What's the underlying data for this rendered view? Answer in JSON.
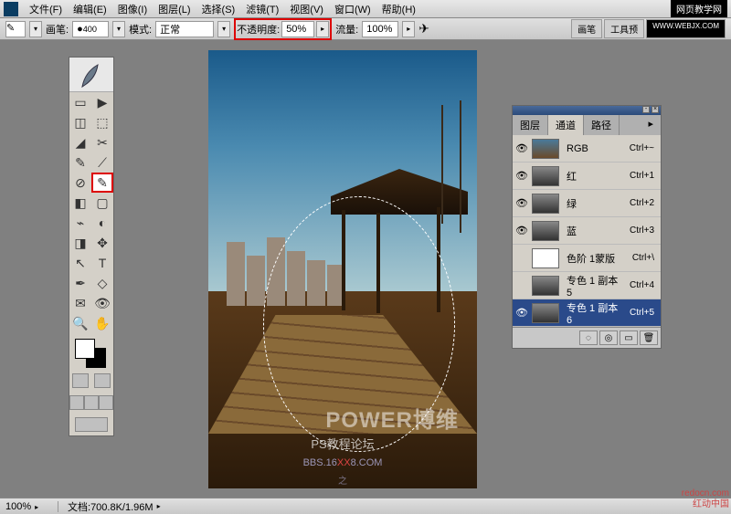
{
  "menubar": {
    "items": [
      "文件(F)",
      "编辑(E)",
      "图像(I)",
      "图层(L)",
      "选择(S)",
      "滤镜(T)",
      "视图(V)",
      "窗口(W)",
      "帮助(H)"
    ],
    "watermark": "网页教学网"
  },
  "optbar": {
    "brush_label": "画笔:",
    "brush_size": "400",
    "mode_label": "模式:",
    "mode_value": "正常",
    "opacity_label": "不透明度:",
    "opacity_value": "50%",
    "flow_label": "流量:",
    "flow_value": "100%",
    "right_tabs": [
      "画笔",
      "工具预"
    ],
    "right_url": "WWW.WEBJX.COM"
  },
  "canvas": {
    "wm_brand": "POWER博维",
    "wm_forum": "PS教程论坛",
    "wm_site_pre": "BBS.16",
    "wm_site_xx": "XX",
    "wm_site_post": "8.COM",
    "wm_extra": "之"
  },
  "panel": {
    "tabs": [
      "图层",
      "通道",
      "路径"
    ],
    "active_tab": 1,
    "rows": [
      {
        "eye": "👁",
        "name": "RGB",
        "shortcut": "Ctrl+~",
        "thumb": "rgb"
      },
      {
        "eye": "👁",
        "name": "红",
        "shortcut": "Ctrl+1",
        "thumb": ""
      },
      {
        "eye": "👁",
        "name": "绿",
        "shortcut": "Ctrl+2",
        "thumb": ""
      },
      {
        "eye": "👁",
        "name": "蓝",
        "shortcut": "Ctrl+3",
        "thumb": ""
      },
      {
        "eye": "",
        "name": "色阶 1蒙版",
        "shortcut": "Ctrl+\\",
        "thumb": "white"
      },
      {
        "eye": "",
        "name": "专色 1 副本 5",
        "shortcut": "Ctrl+4",
        "thumb": ""
      },
      {
        "eye": "👁",
        "name": "专色 1 副本 6",
        "shortcut": "Ctrl+5",
        "thumb": ""
      }
    ],
    "selected": 6
  },
  "statusbar": {
    "zoom": "100%",
    "doc_label": "文档:",
    "doc_value": "700.8K/1.96M"
  },
  "site_wm": {
    "line1": "redocn.com",
    "line2": "红动中国"
  },
  "toolbox_icons": [
    [
      "▭",
      "▶"
    ],
    [
      "◫",
      "⬚"
    ],
    [
      "◢",
      "✂"
    ],
    [
      "✎",
      "⟋"
    ],
    [
      "⊘",
      "✎"
    ],
    [
      "◧",
      "▢"
    ],
    [
      "⌁",
      "◐"
    ],
    [
      "◨",
      "✥"
    ],
    [
      "↖",
      "T"
    ],
    [
      "✒",
      "◇"
    ],
    [
      "✉",
      "👁"
    ],
    [
      "🔍",
      "✋"
    ]
  ]
}
